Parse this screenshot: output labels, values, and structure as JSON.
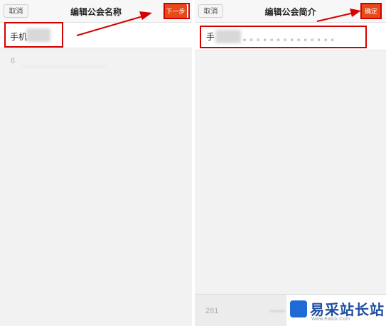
{
  "left": {
    "cancel_label": "取消",
    "title": "编辑公会名称",
    "next_label": "下一步",
    "input_value": "手机",
    "char_count": "6"
  },
  "right": {
    "cancel_label": "取消",
    "title": "编辑公会简介",
    "confirm_label": "确定",
    "input_value": "手",
    "placeholder_dots": "。。。。。。。。。。。。。。",
    "char_count": "281"
  },
  "watermark": {
    "text": "易采站长站",
    "sub": "Www.Easck.Com"
  },
  "colors": {
    "accent": "#e64a19",
    "highlight": "#d40000",
    "watermark": "#1e4ea0"
  }
}
